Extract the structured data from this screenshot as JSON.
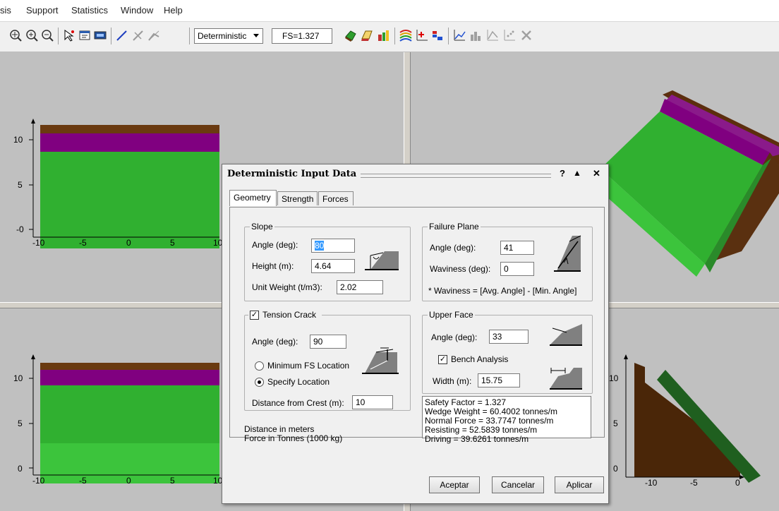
{
  "menu": [
    "sis",
    "Support",
    "Statistics",
    "Window",
    "Help"
  ],
  "toolbar": {
    "analysis_mode": "Deterministic",
    "fs_value": "FS=1.327",
    "icons": [
      "zoom-all-icon",
      "zoom-in-icon",
      "zoom-out-icon",
      "pointer-icon",
      "properties-icon",
      "display-icon",
      "line-icon",
      "hide-icon",
      "measure-icon",
      "render-icon",
      "perspective-icon",
      "color-icon",
      "contour-icon",
      "legend-icon",
      "chart-icon",
      "bar-chart-icon",
      "chart2-icon",
      "chart3-icon",
      "close-chart-icon"
    ]
  },
  "panes": {
    "top_left": {
      "y_ticks": [
        "10",
        "5",
        "-0"
      ],
      "x_ticks": [
        "-10",
        "-5",
        "0",
        "5",
        "10"
      ]
    },
    "bottom_left": {
      "y_ticks": [
        "10",
        "5",
        "0"
      ],
      "x_ticks": [
        "-10",
        "-5",
        "0",
        "5",
        "10"
      ]
    },
    "bottom_right": {
      "y_ticks": [
        "10",
        "5",
        "0"
      ],
      "x_ticks": [
        "-10",
        "-5",
        "0"
      ]
    }
  },
  "colors": {
    "layer_brown": "#6a3a10",
    "layer_purple": "#800080",
    "layer_green": "#30b030",
    "bench_green": "#3cc43c",
    "wedge_dark_green": "#1f5f1f"
  },
  "dialog": {
    "title": "Deterministic Input Data",
    "title_controls": [
      "?",
      "▲",
      "✕"
    ],
    "tabs": [
      "Geometry",
      "Strength",
      "Forces"
    ],
    "slope": {
      "legend": "Slope",
      "angle_label": "Angle (deg):",
      "angle_value": "80",
      "height_label": "Height (m):",
      "height_value": "4.64",
      "unit_weight_label": "Unit Weight (t/m3):",
      "unit_weight_value": "2.02"
    },
    "failure_plane": {
      "legend": "Failure Plane",
      "angle_label": "Angle (deg):",
      "angle_value": "41",
      "waviness_label": "Waviness (deg):",
      "waviness_value": "0",
      "note": "* Waviness = [Avg. Angle] - [Min. Angle]"
    },
    "tension_crack": {
      "legend": "Tension Crack",
      "checked": true,
      "angle_label": "Angle (deg):",
      "angle_value": "90",
      "option_min": "Minimum FS Location",
      "option_specify": "Specify Location",
      "distance_label": "Distance from Crest (m):",
      "distance_value": "10"
    },
    "upper_face": {
      "legend": "Upper Face",
      "angle_label": "Angle (deg):",
      "angle_value": "33",
      "bench_label": "Bench Analysis",
      "bench_checked": true,
      "width_label": "Width (m):",
      "width_value": "15.75"
    },
    "units_note": [
      "Distance in meters",
      "Force in Tonnes (1000 kg)"
    ],
    "results": [
      "Safety Factor = 1.327",
      "Wedge Weight = 60.4002 tonnes/m",
      "Normal Force = 33.7747 tonnes/m",
      "Resisting = 52.5839 tonnes/m",
      "Driving = 39.6261 tonnes/m"
    ],
    "buttons": {
      "ok": "Aceptar",
      "cancel": "Cancelar",
      "apply": "Aplicar"
    }
  }
}
